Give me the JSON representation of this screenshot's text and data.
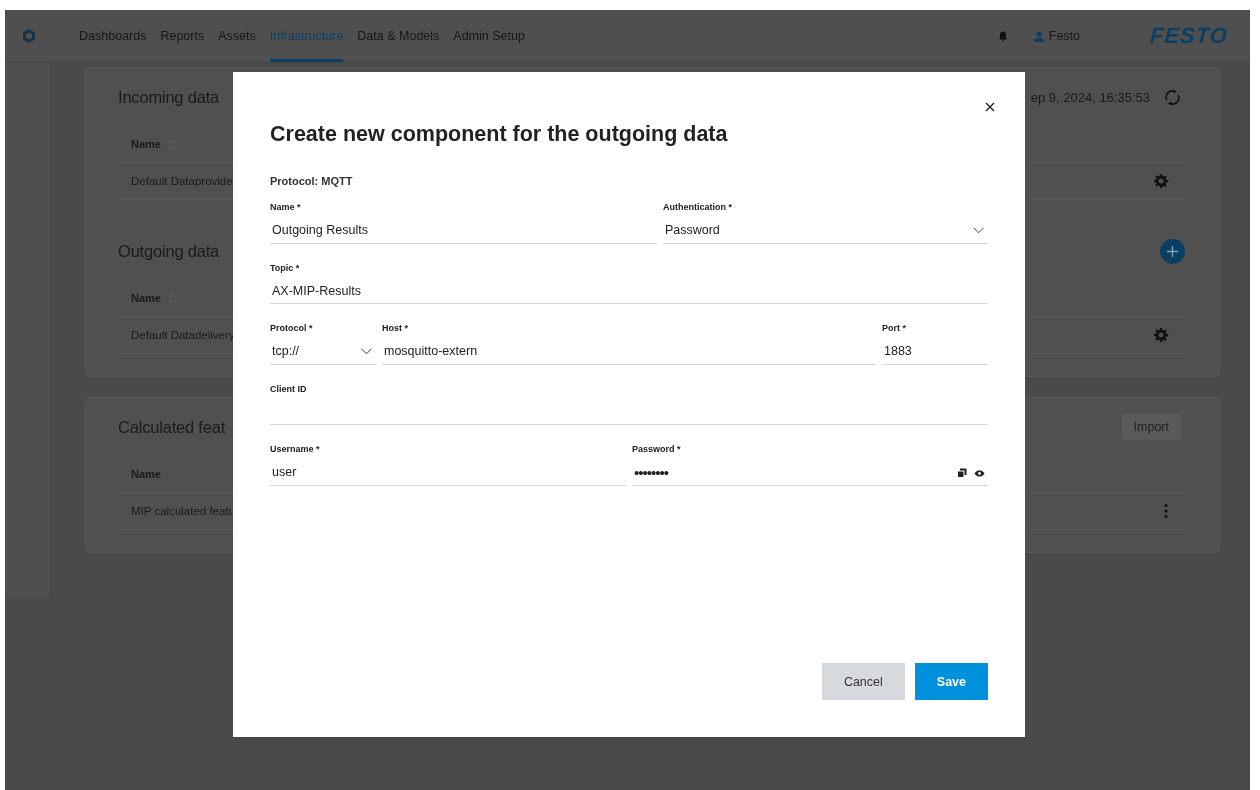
{
  "nav": {
    "items": [
      {
        "label": "Dashboards",
        "selected": false
      },
      {
        "label": "Reports",
        "selected": false
      },
      {
        "label": "Assets",
        "selected": false
      },
      {
        "label": "Infrastructure",
        "selected": true
      },
      {
        "label": "Data & Models",
        "selected": false
      },
      {
        "label": "Admin Setup",
        "selected": false
      }
    ],
    "user": "Festo",
    "brand": "FESTO"
  },
  "sections": [
    {
      "title": "Incoming data",
      "timestamp": "ep 9, 2024, 16:35:53",
      "column": "Name",
      "sortable": true,
      "rows": [
        {
          "name": "Default Dataprovide",
          "kind": "settings"
        }
      ]
    },
    {
      "title": "Outgoing data",
      "add": true,
      "column": "Name",
      "sortable": true,
      "rows": [
        {
          "name": "Default Datadelivery",
          "kind": "settings"
        }
      ]
    },
    {
      "title": "Calculated feat",
      "button": "Import",
      "column": "Name",
      "sortable": false,
      "rows": [
        {
          "name": "MIP calculated featu",
          "kind": "more"
        }
      ]
    }
  ],
  "dialog": {
    "title": "Create new component for the outgoing data",
    "protocol": "Protocol: MQTT",
    "rows": [
      [
        {
          "label": "Name *",
          "value": "Outgoing Results",
          "kind": "text"
        },
        {
          "label": "Authentication *",
          "value": "Password",
          "kind": "select"
        }
      ],
      [
        {
          "label": "Topic *",
          "value": "AX-MIP-Results",
          "kind": "text"
        }
      ],
      [
        {
          "label": "Protocol *",
          "value": "tcp://",
          "kind": "select"
        },
        {
          "label": "Host *",
          "value": "mosquitto-extern",
          "kind": "text"
        },
        {
          "label": "Port *",
          "value": "1883",
          "kind": "text"
        }
      ],
      [
        {
          "label": "Client ID",
          "kind": "text"
        }
      ],
      [
        {
          "label": "Username *",
          "value": "user",
          "kind": "text"
        },
        {
          "label": "Password *",
          "value": "••••••••",
          "kind": "password"
        }
      ]
    ],
    "buttons": [
      {
        "label": "Cancel",
        "kind": "secondary"
      },
      {
        "label": "Save",
        "kind": "primary"
      }
    ]
  }
}
